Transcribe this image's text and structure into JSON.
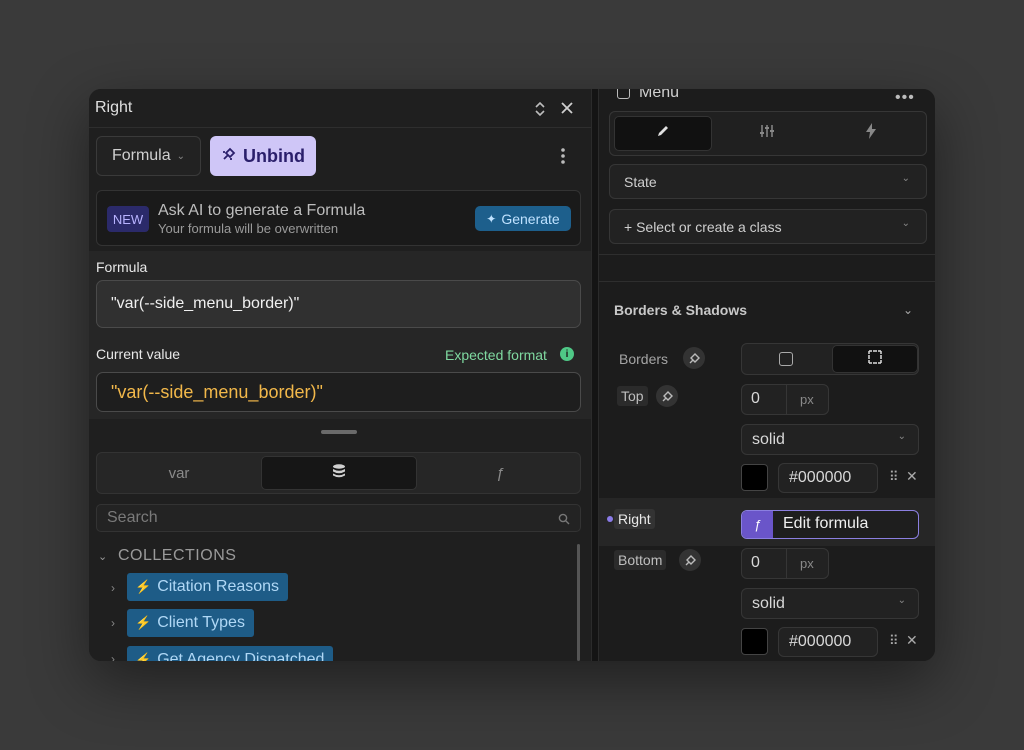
{
  "left_panel": {
    "title": "Right",
    "formula_dropdown": "Formula",
    "unbind_label": "Unbind",
    "ai": {
      "badge": "NEW",
      "title": "Ask AI to generate a Formula",
      "subtitle": "Your formula will be overwritten",
      "generate_label": "Generate"
    },
    "formula_label": "Formula",
    "formula_value": "\"var(--side_menu_border)\"",
    "current_value_label": "Current value",
    "expected_format_label": "Expected format",
    "current_value": "\"var(--side_menu_border)\"",
    "tabs": {
      "var_label": "var",
      "func_label": "ƒ"
    },
    "search_placeholder": "Search",
    "collections_title": "COLLECTIONS",
    "collections": [
      {
        "label": "Citation Reasons"
      },
      {
        "label": "Client Types"
      },
      {
        "label": "Get Agency Dispatched"
      }
    ]
  },
  "right_panel": {
    "menu_title": "Menu",
    "state_label": "State",
    "class_label": "+ Select or create a class",
    "section_title": "Borders & Shadows",
    "borders_label": "Borders",
    "top_label": "Top",
    "right_label": "Right",
    "bottom_label": "Bottom",
    "top": {
      "width": "0",
      "unit": "px",
      "style": "solid",
      "color": "#000000"
    },
    "edit_formula_label": "Edit formula",
    "bottom": {
      "width": "0",
      "unit": "px",
      "style": "solid",
      "color": "#000000"
    }
  },
  "colors": {
    "accent": "#7b5fd6",
    "unbind_bg": "#cfc6f7",
    "expected_green": "#7fd9a0",
    "current_value_orange": "#f2b84a",
    "chip_blue": "#1e5c87"
  }
}
